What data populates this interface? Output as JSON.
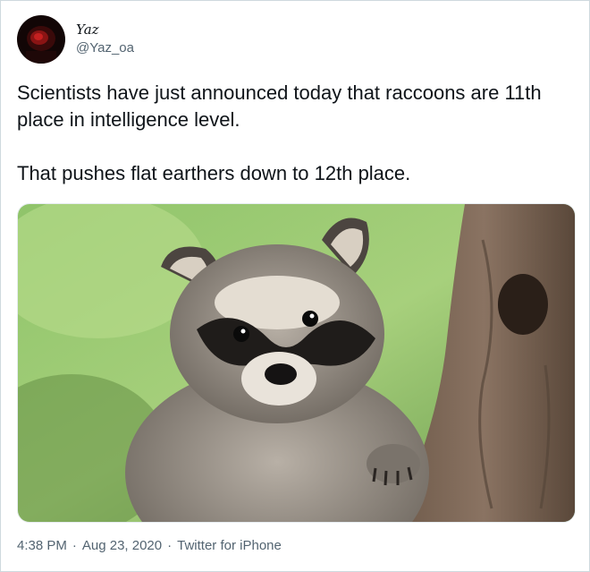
{
  "author": {
    "display_name": "Yaz",
    "handle": "@Yaz_oa"
  },
  "tweet": {
    "text": "Scientists have just announced today that raccoons are 11th place in intelligence level.\n\nThat pushes flat earthers down to 12th place."
  },
  "meta": {
    "time": "4:38 PM",
    "separator": "·",
    "date": "Aug 23, 2020",
    "source": "Twitter for iPhone"
  }
}
